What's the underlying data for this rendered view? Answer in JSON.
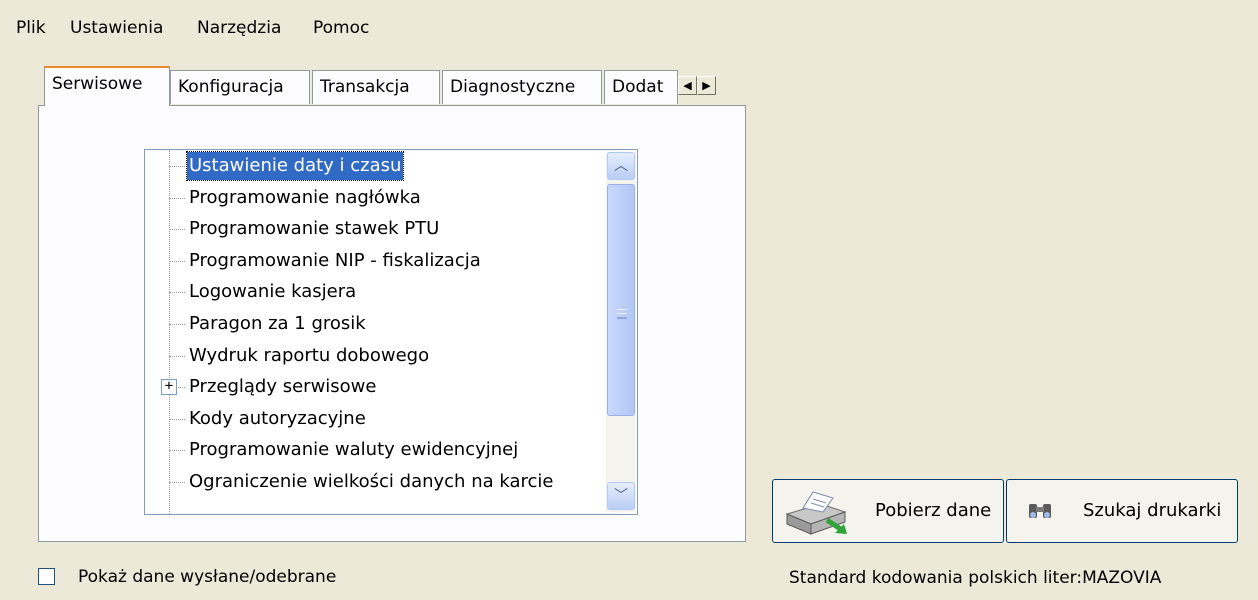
{
  "menu": [
    "Plik",
    "Ustawienia",
    "Narzędzia",
    "Pomoc"
  ],
  "tabs": [
    "Serwisowe",
    "Konfiguracja",
    "Transakcja",
    "Diagnostyczne",
    "Dodat"
  ],
  "tab_scroll": {
    "left_icon": "arrow-left-icon",
    "right_icon": "arrow-right-icon"
  },
  "tree": {
    "selected_index": 0,
    "items": [
      "Ustawienie daty i czasu",
      "Programowanie nagłówka",
      "Programowanie stawek PTU",
      "Programowanie NIP - fiskalizacja",
      "Logowanie kasjera",
      "Paragon za 1 grosik",
      "Wydruk raportu dobowego",
      "Przeglądy serwisowe",
      "Kody autoryzacyjne",
      "Programowanie waluty ewidencyjnej",
      "Ograniczenie wielkości danych na karcie"
    ],
    "expandable_index": 7,
    "expander_glyph": "+"
  },
  "checkbox": {
    "label": "Pokaż dane wysłane/odebrane",
    "checked": false
  },
  "buttons": {
    "fetch_label": "Pobierz dane",
    "fetch_icon": "printer-download-icon",
    "find_label": "Szukaj drukarki",
    "find_icon": "binoculars-icon"
  },
  "status": "Standard kodowania polskich liter:MAZOVIA",
  "colors": {
    "window_bg": "#ece9d8",
    "selection": "#316ac5",
    "tab_accent": "#e68b2c"
  }
}
